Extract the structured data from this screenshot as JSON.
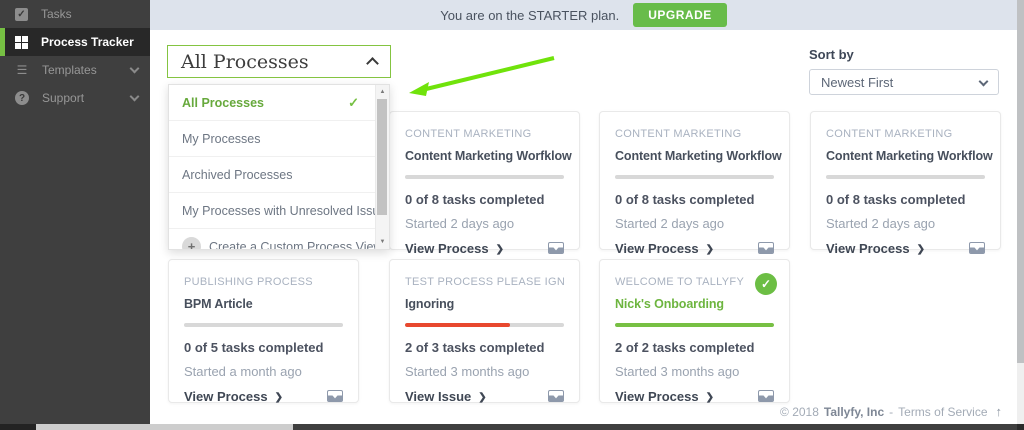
{
  "colors": {
    "accent_green": "#76c043",
    "upgrade_green": "#68bc4a",
    "annotation_green": "#70e30b",
    "star_orange": "#f2b231",
    "issue_red": "#e8482e",
    "complete_green": "#77c043",
    "sidebar_bg": "#3f3f3f",
    "topbar_bg": "#dde3ec"
  },
  "icons": {
    "check": "✓",
    "star": "✱",
    "plus": "+",
    "chevron_right": "❯",
    "up_arrow": "↑",
    "scroll_up": "▲",
    "scroll_down": "▼",
    "question": "?",
    "list": "☰",
    "tasks_check": "✓"
  },
  "sidebar": {
    "items": [
      {
        "label": "Tasks"
      },
      {
        "label": "Process Tracker"
      },
      {
        "label": "Templates"
      },
      {
        "label": "Support"
      }
    ]
  },
  "topbar": {
    "plan_message": "You are on the STARTER plan.",
    "upgrade_label": "UPGRADE"
  },
  "filter": {
    "selected": "All Processes",
    "options": [
      {
        "label": "All Processes"
      },
      {
        "label": "My Processes"
      },
      {
        "label": "Archived Processes"
      },
      {
        "label": "My Processes with Unresolved Issues"
      },
      {
        "label": "Create a Custom Process View"
      }
    ]
  },
  "sort": {
    "label": "Sort by",
    "value": "Newest First"
  },
  "cards": [
    {
      "label": "CONTENT MARKETING",
      "title": "Content Marketing Worfklow",
      "progress": 0,
      "tasks": "0 of 8 tasks completed",
      "started": "Started 2 days ago",
      "action": "View Process"
    },
    {
      "label": "CONTENT MARKETING",
      "title": "Content Marketing Workflow",
      "progress": 0,
      "tasks": "0 of 8 tasks completed",
      "started": "Started 2 days ago",
      "action": "View Process"
    },
    {
      "label": "CONTENT MARKETING",
      "title": "Content Marketing Workflow",
      "progress": 0,
      "tasks": "0 of 8 tasks completed",
      "started": "Started 2 days ago",
      "action": "View Process"
    },
    {
      "label": "PUBLISHING PROCESS",
      "title": "BPM Article",
      "progress": 0,
      "tasks": "0 of 5 tasks completed",
      "started": "Started a month ago",
      "action": "View Process"
    },
    {
      "label": "TEST PROCESS PLEASE IGNORE",
      "title": "Ignoring",
      "progress": 66,
      "tasks": "2 of 3 tasks completed",
      "started": "Started 3 months ago",
      "action": "View Issue"
    },
    {
      "label": "WELCOME TO TALLYFY",
      "title": "Nick's Onboarding",
      "progress": 100,
      "tasks": "2 of 2 tasks completed",
      "started": "Started 3 months ago",
      "action": "View Process"
    }
  ],
  "footer": {
    "copyright": "© 2018",
    "company": "Tallyfy, Inc",
    "separator": "-",
    "terms": "Terms of Service"
  }
}
